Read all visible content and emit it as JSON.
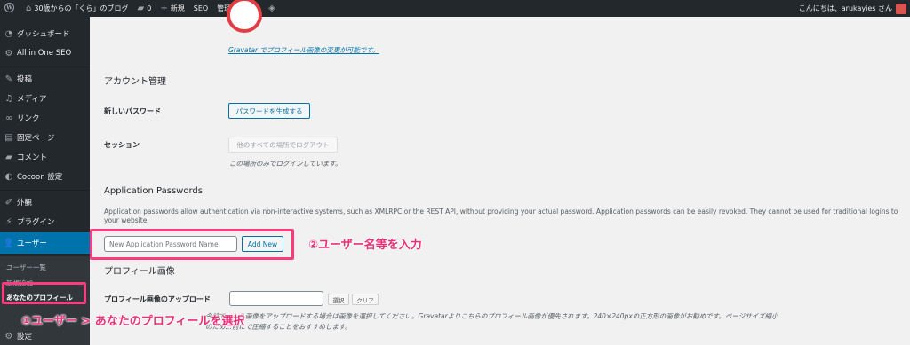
{
  "adminbar": {
    "site_name": "30歳からの「くら」のブログ",
    "comments_count": "0",
    "new_label": "新規",
    "seo_label": "SEO",
    "admin_menu_label": "管理メニュー",
    "greeting": "こんにちは、arukayies さん"
  },
  "sidebar": {
    "items": [
      {
        "label": "ダッシュボード",
        "icon": "gauge-icon"
      },
      {
        "label": "All in One SEO",
        "icon": "gear-icon"
      },
      {
        "label": "投稿",
        "icon": "pin-icon"
      },
      {
        "label": "メディア",
        "icon": "media-icon"
      },
      {
        "label": "リンク",
        "icon": "link-icon"
      },
      {
        "label": "固定ページ",
        "icon": "page-icon"
      },
      {
        "label": "コメント",
        "icon": "comment-icon"
      },
      {
        "label": "Cocoon 設定",
        "icon": "cocoon-icon"
      },
      {
        "label": "外観",
        "icon": "brush-icon"
      },
      {
        "label": "プラグイン",
        "icon": "plugin-icon"
      },
      {
        "label": "ユーザー",
        "icon": "user-icon"
      },
      {
        "label": "設定",
        "icon": "settings-icon"
      }
    ],
    "submenu": [
      "ユーザー一覧",
      "新規追加",
      "あなたのプロフィール"
    ]
  },
  "profile": {
    "gravatar_link": "Gravatar でプロフィール画像の変更が可能です。",
    "account_heading": "アカウント管理",
    "new_password_label": "新しいパスワード",
    "generate_password_button": "パスワードを生成する",
    "session_label": "セッション",
    "logout_everywhere_button": "他のすべての場所でログアウト",
    "session_desc": "この場所のみでログインしています。",
    "app_passwords_heading": "Application Passwords",
    "app_passwords_desc": "Application passwords allow authentication via non-interactive systems, such as XMLRPC or the REST API, without providing your actual password. Application passwords can be easily revoked. They cannot be used for traditional logins to your website.",
    "app_password_placeholder": "New Application Password Name",
    "add_new_button": "Add New",
    "profile_image_heading": "プロフィール画像",
    "profile_image_upload_label": "プロフィール画像のアップロード",
    "select_button": "選択",
    "clear_button": "クリア",
    "upload_desc_1": "今前で…ール画像をアップロードする場合は画像を選択してください。Gravatarよりこちらのプロフィール画像が優先されます。240×240pxの正方形の画像がお勧めです。ページサイズ縮小",
    "upload_desc_2": "のため…前にで圧縮することをおすすめします。"
  },
  "annotations": {
    "step1": "①ユーザー > あなたのプロフィールを選択",
    "step2": "②ユーザー名等を入力"
  },
  "colors": {
    "admin_bg": "#23282d",
    "accent": "#0073aa",
    "highlight": "#ff3b7f"
  }
}
